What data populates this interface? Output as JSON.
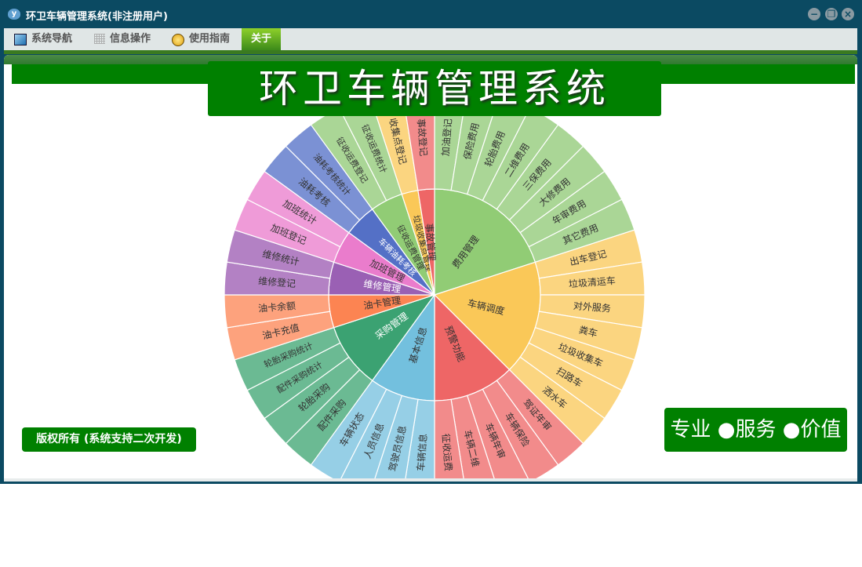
{
  "window": {
    "title": "环卫车辆管理系统(非注册用户)",
    "app_icon": "y"
  },
  "menu": {
    "items": [
      {
        "label": "系统导航",
        "icon": "monitor-icon"
      },
      {
        "label": "信息操作",
        "icon": "grid-icon"
      },
      {
        "label": "使用指南",
        "icon": "help-icon"
      }
    ],
    "active": {
      "label": "关于"
    }
  },
  "header": {
    "title": "环卫车辆管理系统"
  },
  "footer": {
    "copyright": "版权所有 (系统支持二次开发)",
    "slogan": "专业 ●服务 ●价值"
  },
  "colors": {
    "frame": "#0b4a62",
    "brand_green": "#008000"
  },
  "chart_data": {
    "type": "sunburst",
    "start": "top, clockwise",
    "series": [
      {
        "name": "费用管理",
        "color": "#91cc75",
        "outer": "#aad696",
        "text": "#333",
        "children": [
          "加油登记",
          "保险费用",
          "轮胎费用",
          "二维费用",
          "三保费用",
          "大修费用",
          "年审费用",
          "其它费用"
        ]
      },
      {
        "name": "车辆调度",
        "color": "#fac858",
        "outer": "#fbd580",
        "text": "#333",
        "children": [
          "出车登记",
          "垃圾清运车",
          "对外服务",
          "粪车",
          "垃圾收集车",
          "扫路车",
          "洒水车"
        ]
      },
      {
        "name": "预警功能",
        "color": "#ee6666",
        "outer": "#f28b8b",
        "text": "#333",
        "children": [
          "驾证年审",
          "车辆保险",
          "车辆年审",
          "车辆二维",
          "征收运费"
        ]
      },
      {
        "name": "基本信息",
        "color": "#73c0de",
        "outer": "#96cfe6",
        "text": "#333",
        "children": [
          "车辆信息",
          "驾驶员信息",
          "人员信息",
          "车辆状态"
        ]
      },
      {
        "name": "采购管理",
        "color": "#3ba272",
        "outer": "#6bba93",
        "text": "#fff",
        "children": [
          "配件采购",
          "轮胎采购",
          "配件采购统计",
          "轮胎采购统计"
        ]
      },
      {
        "name": "油卡管理",
        "color": "#fc8452",
        "outer": "#fda27d",
        "text": "#333",
        "children": [
          "油卡充值",
          "油卡余额"
        ]
      },
      {
        "name": "维修管理",
        "color": "#9a60b4",
        "outer": "#b381c4",
        "text": "#fff",
        "children": [
          "维修登记",
          "维修统计"
        ]
      },
      {
        "name": "加班管理",
        "color": "#ea7ccc",
        "outer": "#ef9bd8",
        "text": "#333",
        "children": [
          "加班登记",
          "加班统计"
        ]
      },
      {
        "name": "车辆油耗考核",
        "color": "#5470c6",
        "outer": "#7b91d4",
        "text": "#fff",
        "children": [
          "油耗考核",
          "油耗考核统计"
        ]
      },
      {
        "name": "征收运费管理",
        "color": "#91cc75",
        "outer": "#aad696",
        "text": "#333",
        "children": [
          "征收运费登记",
          "征收运费统计"
        ]
      },
      {
        "name": "垃圾收集点管理",
        "color": "#fac858",
        "outer": "#fbd580",
        "text": "#333",
        "children": [
          "收集点登记"
        ]
      },
      {
        "name": "事故管理",
        "color": "#ee6666",
        "outer": "#f28b8b",
        "text": "#333",
        "children": [
          "事故登记"
        ]
      }
    ]
  }
}
